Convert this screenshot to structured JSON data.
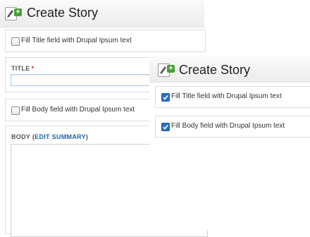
{
  "back_form": {
    "title": "Create Story",
    "fill_title_label": "Fill Title field with Drupal Ipsum text",
    "fill_title_checked": false,
    "title_field_label": "TITLE",
    "required_marker": "*",
    "title_value": "",
    "fill_body_label": "Fill Body field with Drupal Ipsum text",
    "fill_body_checked": false,
    "body_label": "BODY",
    "body_paren_open": " (",
    "edit_summary_link": "EDIT SUMMARY",
    "body_paren_close": ")",
    "body_value": ""
  },
  "front_form": {
    "title": "Create Story",
    "fill_title_label": "Fill Title field with Drupal Ipsum text",
    "fill_title_checked": true,
    "fill_body_label": "Fill Body field with Drupal Ipsum text",
    "fill_body_checked": true
  },
  "icons": {
    "app_icon": "edit-document-add-icon",
    "checkbox_checked": "checkmark-icon"
  },
  "colors": {
    "accent_green": "#44a033",
    "link_blue": "#1c64b4",
    "required_red": "#d21d1d",
    "checkbox_blue": "#2e6fc9"
  }
}
